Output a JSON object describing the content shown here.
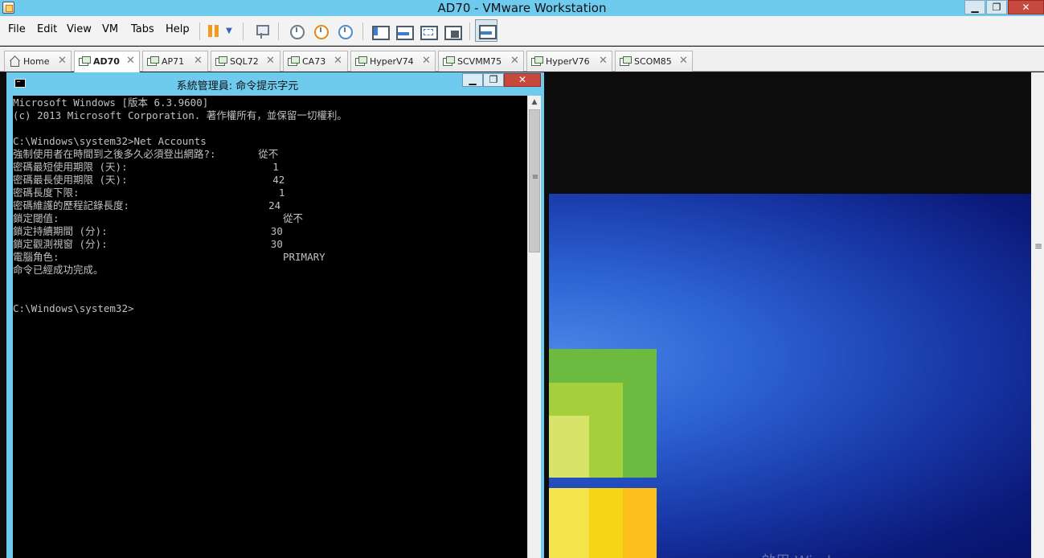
{
  "window": {
    "title": "AD70 - VMware Workstation",
    "minimize_label": "▁",
    "maximize_label": "❐",
    "close_label": "✕"
  },
  "menu": {
    "items": [
      "File",
      "Edit",
      "View",
      "VM",
      "Tabs",
      "Help"
    ]
  },
  "toolbar": {
    "icons": [
      "pause-icon",
      "dropdown-caret-icon",
      "network-icon",
      "snapshot-icon",
      "revert-snapshot-icon",
      "snapshot-manager-icon",
      "library-view-icon",
      "thumbnail-bar-icon",
      "full-screen-icon",
      "unity-icon",
      "console-view-icon"
    ],
    "accent": "#f29a1d"
  },
  "tabs": [
    {
      "label": "Home",
      "icon": "home-icon",
      "active": false
    },
    {
      "label": "AD70",
      "icon": "vm-icon",
      "active": true
    },
    {
      "label": "AP71",
      "icon": "vm-icon",
      "active": false
    },
    {
      "label": "SQL72",
      "icon": "vm-icon",
      "active": false
    },
    {
      "label": "CA73",
      "icon": "vm-icon",
      "active": false
    },
    {
      "label": "HyperV74",
      "icon": "vm-icon",
      "active": false
    },
    {
      "label": "SCVMM75",
      "icon": "vm-icon",
      "active": false
    },
    {
      "label": "HyperV76",
      "icon": "vm-icon",
      "active": false
    },
    {
      "label": "SCOM85",
      "icon": "vm-icon",
      "active": false
    }
  ],
  "tab_close_label": "✕",
  "cmd": {
    "title": "系統管理員: 命令提示字元",
    "lines": [
      "Microsoft Windows [版本 6.3.9600]",
      "(c) 2013 Microsoft Corporation. 著作權所有，並保留一切權利。",
      "",
      "C:\\Windows\\system32>Net Accounts",
      "強制使用者在時間到之後多久必須登出網路?:       從不",
      "密碼最短使用期限 (天):                        1",
      "密碼最長使用期限 (天):                        42",
      "密碼長度下限:                                 1",
      "密碼維護的歷程記錄長度:                       24",
      "鎖定閾值:                                     從不",
      "鎖定持續期間 (分):                           30",
      "鎖定觀測視窗 (分):                           30",
      "電腦角色:                                     PRIMARY",
      "命令已經成功完成。",
      "",
      "",
      "C:\\Windows\\system32>"
    ],
    "text_color": "#c0c0c0",
    "background": "#000000"
  },
  "desktop": {
    "watermark": "啟用 Windows",
    "frame_color": "#6fcbee"
  }
}
